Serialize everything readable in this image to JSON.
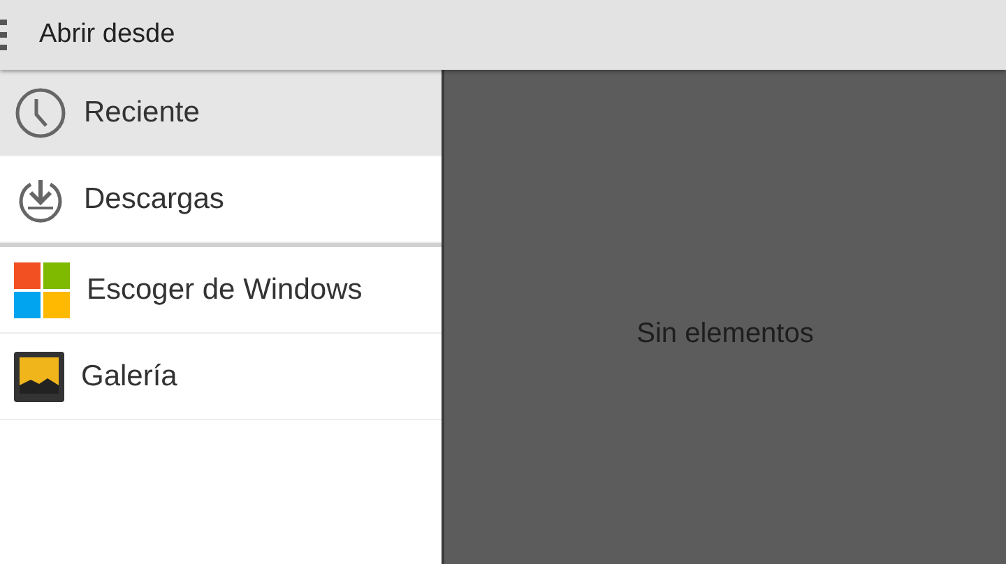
{
  "toolbar": {
    "title": "Abrir desde"
  },
  "sidebar": {
    "sections": [
      {
        "items": [
          {
            "label": "Reciente",
            "kind": "clock",
            "selected": true
          },
          {
            "label": "Descargas",
            "kind": "download",
            "selected": false
          }
        ]
      },
      {
        "items": [
          {
            "label": "Escoger de Windows",
            "kind": "windows",
            "selected": false
          },
          {
            "label": "Galería",
            "kind": "gallery",
            "selected": false
          }
        ]
      }
    ]
  },
  "content": {
    "empty_message": "Sin elementos"
  }
}
